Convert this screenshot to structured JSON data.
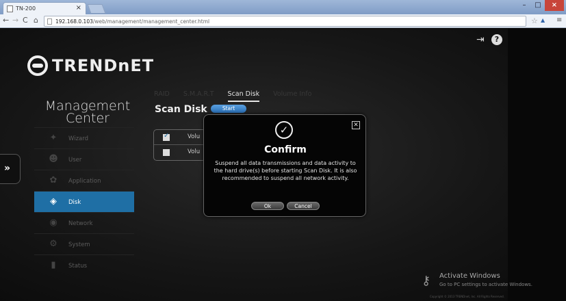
{
  "browser": {
    "tab_title": "TN-200",
    "tab_close": "×",
    "url_host": "192.168.0.103",
    "url_path": "/web/management/management_center.html"
  },
  "header": {
    "logo_text": "TRENDnET"
  },
  "sidebar": {
    "title_line1": "Management",
    "title_line2": "Center",
    "expand_label": "»",
    "items": [
      {
        "label": "Wizard",
        "icon": "wizard-icon",
        "active": false
      },
      {
        "label": "User",
        "icon": "user-icon",
        "active": false
      },
      {
        "label": "Application",
        "icon": "application-icon",
        "active": false
      },
      {
        "label": "Disk",
        "icon": "disk-icon",
        "active": true
      },
      {
        "label": "Network",
        "icon": "network-icon",
        "active": false
      },
      {
        "label": "System",
        "icon": "system-icon",
        "active": false
      },
      {
        "label": "Status",
        "icon": "status-icon",
        "active": false
      }
    ]
  },
  "main": {
    "tabs": [
      {
        "label": "RAID",
        "active": false
      },
      {
        "label": "S.M.A.R.T",
        "active": false
      },
      {
        "label": "Scan Disk",
        "active": true
      },
      {
        "label": "Volume Info",
        "active": false
      }
    ],
    "section_title": "Scan Disk",
    "start_label": "Start",
    "volumes": [
      {
        "label": "Volu",
        "checked": true
      },
      {
        "label": "Volu",
        "checked": false
      }
    ]
  },
  "modal": {
    "title": "Confirm",
    "message": "Suspend all data transmissions and data activity to the hard drive(s) before starting Scan Disk. It is also recommended to suspend all network activity.",
    "ok_label": "Ok",
    "cancel_label": "Cancel",
    "close_label": "✕"
  },
  "watermark": {
    "title": "Activate Windows",
    "subtitle": "Go to PC settings to activate Windows.",
    "copyright": "Copyright © 2013 TRENDnet, Inc. All Rights Reserved."
  },
  "colors": {
    "accent": "#1f6fa5",
    "background": "#161616",
    "start_button": "#3d87cc"
  }
}
